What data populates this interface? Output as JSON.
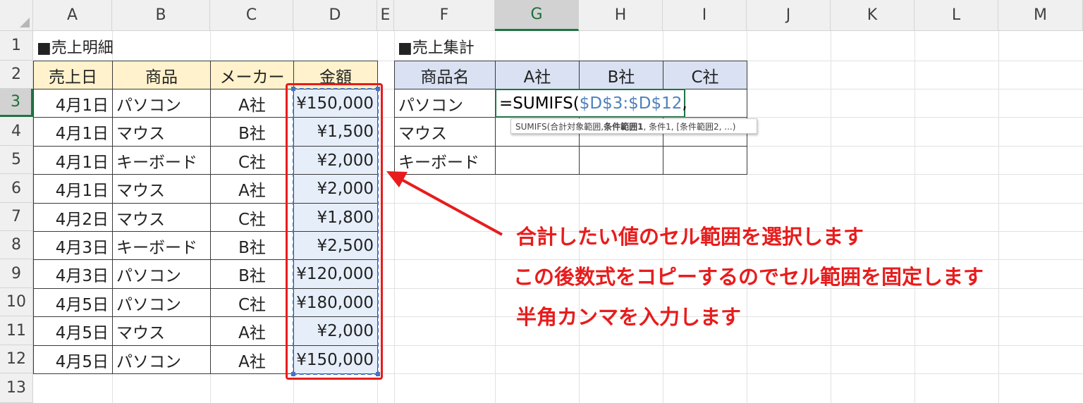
{
  "columns": [
    "A",
    "B",
    "C",
    "D",
    "E",
    "F",
    "G",
    "H",
    "I",
    "J",
    "K",
    "L",
    "M"
  ],
  "rows": [
    "1",
    "2",
    "3",
    "4",
    "5",
    "6",
    "7",
    "8",
    "9",
    "10",
    "11",
    "12",
    "13"
  ],
  "left_title": "■売上明細",
  "right_title": "■売上集計",
  "left_headers": [
    "売上日",
    "商品",
    "メーカー",
    "金額"
  ],
  "sales": [
    {
      "date": "4月1日",
      "product": "パソコン",
      "maker": "A社",
      "amount": "¥150,000"
    },
    {
      "date": "4月1日",
      "product": "マウス",
      "maker": "B社",
      "amount": "¥1,500"
    },
    {
      "date": "4月1日",
      "product": "キーボード",
      "maker": "C社",
      "amount": "¥2,000"
    },
    {
      "date": "4月1日",
      "product": "マウス",
      "maker": "A社",
      "amount": "¥2,000"
    },
    {
      "date": "4月2日",
      "product": "マウス",
      "maker": "C社",
      "amount": "¥1,800"
    },
    {
      "date": "4月3日",
      "product": "キーボード",
      "maker": "B社",
      "amount": "¥2,500"
    },
    {
      "date": "4月3日",
      "product": "パソコン",
      "maker": "B社",
      "amount": "¥120,000"
    },
    {
      "date": "4月5日",
      "product": "パソコン",
      "maker": "C社",
      "amount": "¥180,000"
    },
    {
      "date": "4月5日",
      "product": "マウス",
      "maker": "A社",
      "amount": "¥2,000"
    },
    {
      "date": "4月5日",
      "product": "パソコン",
      "maker": "A社",
      "amount": "¥150,000"
    }
  ],
  "summary_headers": [
    "商品名",
    "A社",
    "B社",
    "C社"
  ],
  "summary_rows": [
    "パソコン",
    "マウス",
    "キーボード"
  ],
  "formula": {
    "prefix": "=SUMIFS(",
    "ref": "$D$3:$D$12",
    "suffix": ","
  },
  "tooltip": {
    "p1": "SUMIFS(合計対象範囲, ",
    "bold": "条件範囲1",
    "p2": ", 条件1, [条件範囲2, ...)"
  },
  "annotations": [
    "合計したい値のセル範囲を選択します",
    "この後数式をコピーするのでセル範囲を固定します",
    "半角カンマを入力します"
  ],
  "colors": {
    "accent": "#e81c1c",
    "header_yellow": "#fff2cc",
    "header_blue": "#d9e1f2",
    "ref_blue": "#4f81bd",
    "excel_green": "#217346"
  }
}
